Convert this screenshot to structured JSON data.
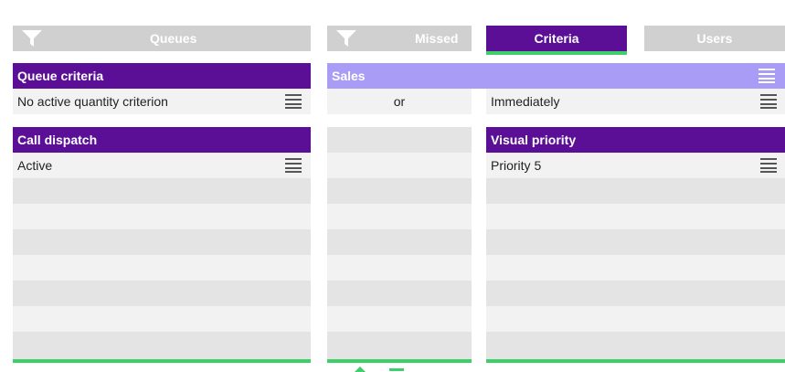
{
  "tabs": {
    "queues": "Queues",
    "missed": "Missed",
    "criteria": "Criteria",
    "users": "Users"
  },
  "left": {
    "queue_criteria_title": "Queue criteria",
    "queue_criteria_value": "No active quantity criterion",
    "call_dispatch_title": "Call dispatch",
    "call_dispatch_value": "Active"
  },
  "middle": {
    "sales_title": "Sales",
    "connector": "or"
  },
  "right": {
    "timing_value": "Immediately",
    "visual_priority_title": "Visual priority",
    "visual_priority_value": "Priority 5"
  },
  "colors": {
    "accent_purple": "#5a0f96",
    "light_purple": "#a89cf6",
    "active_green": "#3ecf6a",
    "tab_grey": "#d0d0d0"
  }
}
